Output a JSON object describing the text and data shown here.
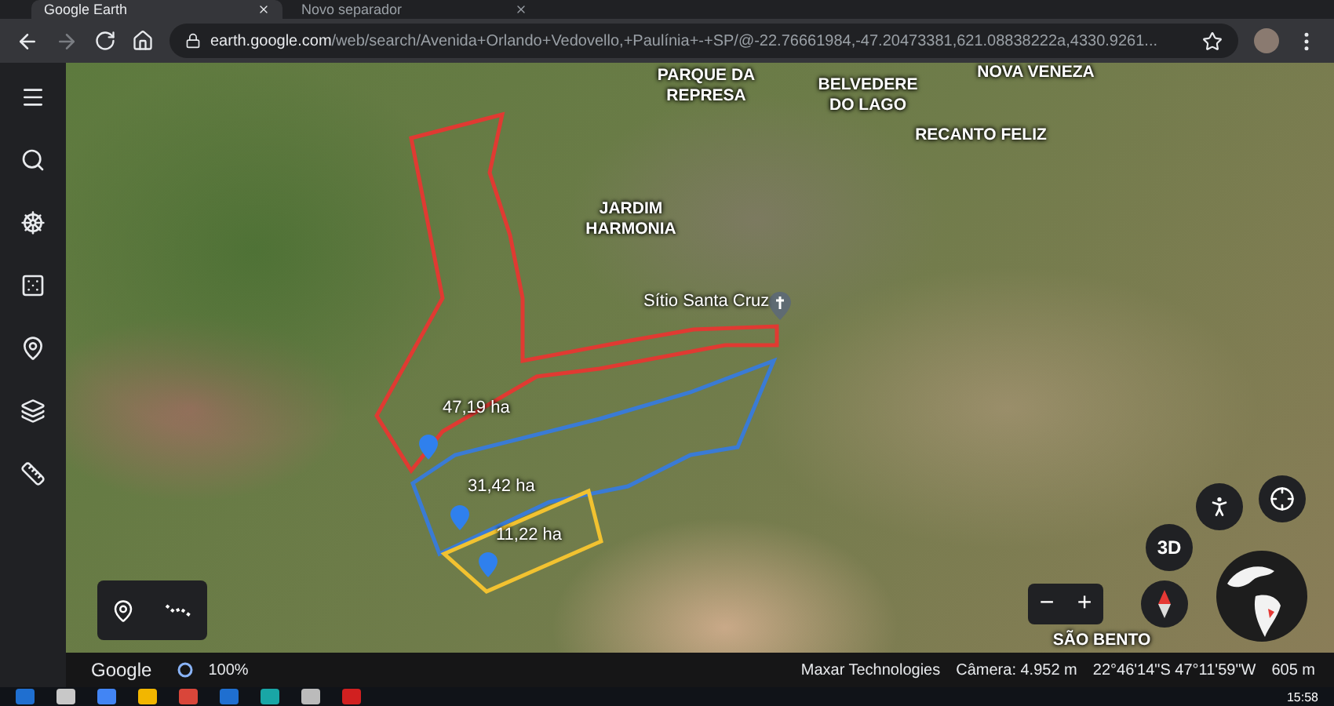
{
  "browser_tabs": [
    {
      "label": "Google Earth",
      "selected": true
    },
    {
      "label": "Novo separador",
      "selected": false
    }
  ],
  "address_bar": {
    "url": "**earth.google.com**/web/search/Avenida+Orlando+Vedovello,+Paulínia+-+SP/@-22.76661984,-47.20473381,621.08838222a,4330.9261..."
  },
  "map": {
    "place_labels": [
      "PARQUE DA\nREPRESA",
      "BELVEDERE\nDO LAGO",
      "NOVA VENEZA",
      "RECANTO FELIZ",
      "JARDIM\nHARMONIA",
      "SÃO BENTO"
    ],
    "landmark": {
      "label": "Sítio Santa Cruz"
    },
    "areas": [
      {
        "label": "47,19 ha",
        "color": "#e03a32"
      },
      {
        "label": "31,42 ha",
        "color": "#3a7bd5"
      },
      {
        "label": "11,22 ha",
        "color": "#f2c230"
      }
    ],
    "controls": {
      "three_d": "3D",
      "zoom_out": "−",
      "zoom_in": "+"
    }
  },
  "status_bar": {
    "brand": "Google",
    "loading": "100%",
    "imagery": "Maxar Technologies",
    "camera": "Câmera: 4.952 m",
    "coordinates": "22°46'14\"S 47°11'59\"W",
    "elevation": "605 m"
  },
  "taskbar": {
    "clock": "15:58"
  }
}
